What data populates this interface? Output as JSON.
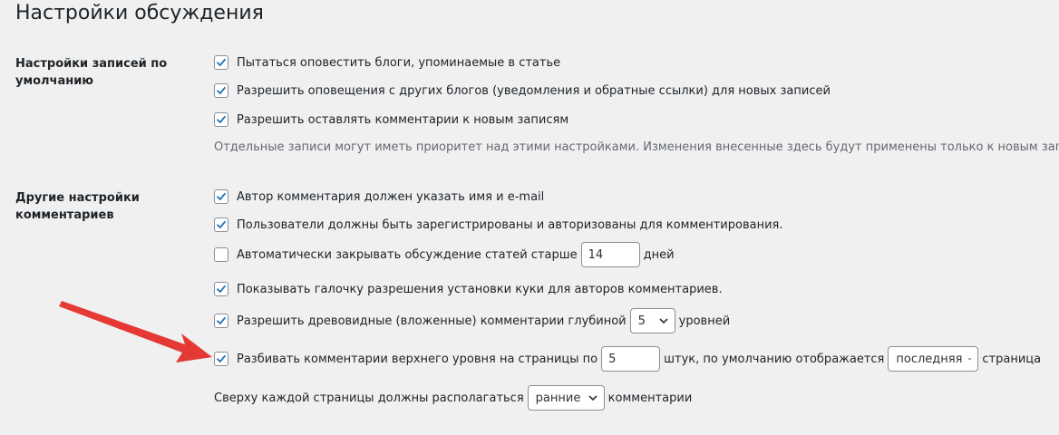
{
  "page": {
    "title": "Настройки обсуждения"
  },
  "default_post": {
    "label": "Настройки записей по умолчанию",
    "options": [
      {
        "text": "Пытаться оповестить блоги, упоминаемые в статье",
        "checked": true
      },
      {
        "text": "Разрешить оповещения с других блогов (уведомления и обратные ссылки) для новых записей",
        "checked": true
      },
      {
        "text": "Разрешить оставлять комментарии к новым записям",
        "checked": true
      }
    ],
    "note": "Отдельные записи могут иметь приоритет над этими настройками. Изменения внесенные здесь будут применены только к новым записям."
  },
  "other_comments": {
    "label": "Другие настройки комментариев",
    "require_name_email": {
      "text": "Автор комментария должен указать имя и e-mail",
      "checked": true
    },
    "registered_only": {
      "text": "Пользователи должны быть зарегистрированы и авторизованы для комментирования.",
      "checked": true
    },
    "auto_close": {
      "before": "Автоматически закрывать обсуждение статей старше",
      "value": "14",
      "after": "дней",
      "checked": false
    },
    "cookies_opt_in": {
      "text": "Показывать галочку разрешения установки куки для авторов комментариев.",
      "checked": true
    },
    "threaded": {
      "before": "Разрешить древовидные (вложенные) комментарии глубиной",
      "value": "5",
      "after": "уровней",
      "checked": true
    },
    "paginate": {
      "before": "Разбивать комментарии верхнего уровня на страницы по",
      "value": "5",
      "middle": "штук, по умолчанию отображается",
      "select_value": "последняя",
      "after": "страница",
      "checked": true
    },
    "order": {
      "before": "Сверху каждой страницы должны располагаться",
      "select_value": "ранние",
      "after": "комментарии"
    }
  },
  "colors": {
    "accent": "#2271b1",
    "arrow": "#e53935"
  }
}
